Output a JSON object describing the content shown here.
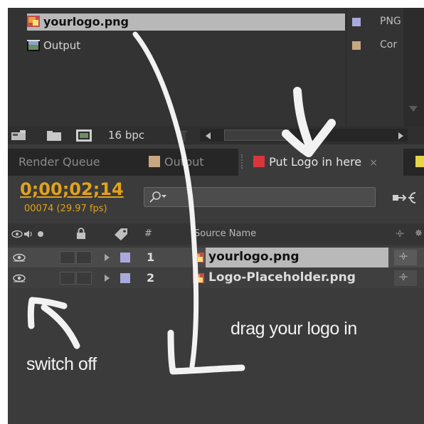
{
  "project": {
    "items": [
      {
        "name": "yourlogo.png",
        "type": "PNG",
        "swatch": "#a9a9dc",
        "selected": true
      },
      {
        "name": "Output",
        "type": "Cor",
        "swatch": "#c7a77f",
        "selected": false
      }
    ],
    "toolbar": {
      "bit_depth": "16 bpc"
    }
  },
  "tabs": [
    {
      "label": "Render Queue",
      "swatch": null,
      "active": false
    },
    {
      "label": "Output",
      "swatch": "#c7a77f",
      "active": false
    },
    {
      "label": "Put Logo in here",
      "swatch": "#d9363b",
      "active": true,
      "close": "×"
    },
    {
      "label": "",
      "swatch": "#e7d544",
      "active": false
    }
  ],
  "timeline": {
    "timecode": "0;00;02;14",
    "frames_fps": "00074 (29.97 fps)",
    "search_placeholder": "",
    "columns": {
      "hash": "#",
      "source_name": "Source Name"
    },
    "layers": [
      {
        "number": "1",
        "name": "yourlogo.png",
        "label_color": "#a9a9dc",
        "selected": true
      },
      {
        "number": "2",
        "name": "Logo-Placeholder.png",
        "label_color": "#a9a9dc",
        "selected": false
      }
    ]
  },
  "annotations": {
    "drag": "drag your logo in",
    "switch": "switch off"
  },
  "icons": [
    "footage-icon",
    "composition-icon",
    "interpret-footage-icon",
    "new-folder-icon",
    "new-composition-icon",
    "trash-icon",
    "search-icon",
    "eye-icon",
    "audio-icon",
    "solo-icon",
    "lock-icon",
    "label-icon",
    "close-icon",
    "comp-flowchart-icon"
  ]
}
